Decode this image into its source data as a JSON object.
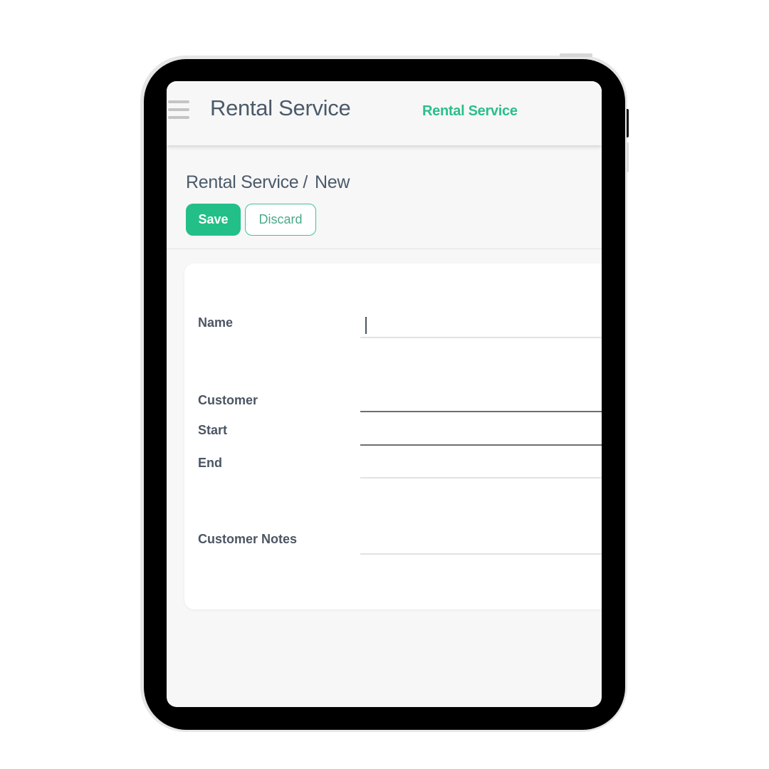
{
  "navbar": {
    "menu_icon": "hamburger-icon",
    "app_title": "Rental Service",
    "menu_item": "Rental Service",
    "accent_color": "#2bbf8a"
  },
  "control_panel": {
    "breadcrumb": {
      "parent": "Rental Service",
      "separator": "/",
      "current": "New"
    },
    "save_label": "Save",
    "discard_label": "Discard"
  },
  "form": {
    "fields": [
      {
        "label": "Name",
        "value": ""
      },
      {
        "label": "Customer",
        "value": ""
      },
      {
        "label": "Start",
        "value": ""
      },
      {
        "label": "End",
        "value": ""
      },
      {
        "label": "Customer Notes",
        "value": ""
      }
    ]
  }
}
